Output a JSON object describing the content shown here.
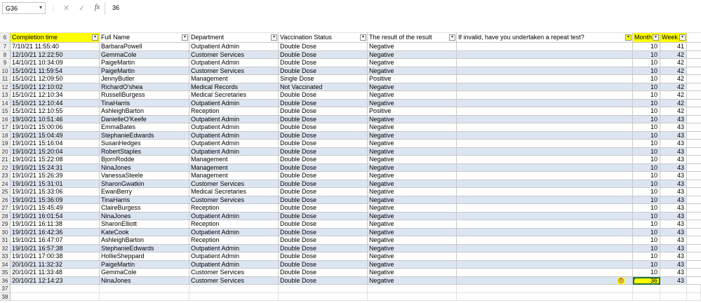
{
  "formula_bar": {
    "name_box": "G36",
    "name_box_arrow": "▾",
    "separator": "⋮",
    "cancel_icon": "✕",
    "enter_icon": "✓",
    "fx": "fx",
    "value": "36"
  },
  "headers": {
    "row_number": "6",
    "columns": [
      "Completion time",
      "Full Name",
      "Department",
      "Vaccination Status",
      "The result of the result",
      "If invalid, have you undertaken a repeat test?",
      "Month",
      "Week"
    ]
  },
  "rows": [
    {
      "n": "7",
      "t": "7/10/21 11:55:40",
      "name": "BarbaraPowell",
      "dept": "Outpatient Admin",
      "vacc": "Double Dose",
      "res": "Negative",
      "rep": "",
      "m": "10",
      "w": "41"
    },
    {
      "n": "8",
      "t": "12/10/21 12:22:50",
      "name": "GemmaCole",
      "dept": "Customer Services",
      "vacc": "Double Dose",
      "res": "Negative",
      "rep": "",
      "m": "10",
      "w": "42"
    },
    {
      "n": "9",
      "t": "14/10/21 10:34:09",
      "name": "PaigeMartin",
      "dept": "Outpatient Admin",
      "vacc": "Double Dose",
      "res": "Negative",
      "rep": "",
      "m": "10",
      "w": "42"
    },
    {
      "n": "10",
      "t": "15/10/21 11:59:54",
      "name": "PaigeMartin",
      "dept": "Customer Services",
      "vacc": "Double Dose",
      "res": "Negative",
      "rep": "",
      "m": "10",
      "w": "42"
    },
    {
      "n": "11",
      "t": "15/10/21 12:09:50",
      "name": "JennyButler",
      "dept": "Management",
      "vacc": "Single Dose",
      "res": "Positive",
      "rep": "",
      "m": "10",
      "w": "42"
    },
    {
      "n": "12",
      "t": "15/10/21 12:10:02",
      "name": "RichardO'shea",
      "dept": "Medical Records",
      "vacc": "Not Vaccinated",
      "res": "Negative",
      "rep": "",
      "m": "10",
      "w": "42"
    },
    {
      "n": "13",
      "t": "15/10/21 12:10:34",
      "name": "RussellBurgess",
      "dept": "Medical Secretaries",
      "vacc": "Double Dose",
      "res": "Negative",
      "rep": "",
      "m": "10",
      "w": "42"
    },
    {
      "n": "14",
      "t": "15/10/21 12:10:44",
      "name": "TinaHarris",
      "dept": "Outpatient Admin",
      "vacc": "Double Dose",
      "res": "Negative",
      "rep": "",
      "m": "10",
      "w": "42"
    },
    {
      "n": "15",
      "t": "15/10/21 12:10:55",
      "name": "AshleighBarton",
      "dept": "Reception",
      "vacc": "Double Dose",
      "res": "Positive",
      "rep": "",
      "m": "10",
      "w": "42"
    },
    {
      "n": "16",
      "t": "19/10/21 10:51:46",
      "name": "DanielleO'Keefe",
      "dept": "Outpatient Admin",
      "vacc": "Double Dose",
      "res": "Negative",
      "rep": "",
      "m": "10",
      "w": "43"
    },
    {
      "n": "17",
      "t": "19/10/21 15:00:06",
      "name": "EmmaBates",
      "dept": "Outpatient Admin",
      "vacc": "Double Dose",
      "res": "Negative",
      "rep": "",
      "m": "10",
      "w": "43"
    },
    {
      "n": "18",
      "t": "19/10/21 15:04:49",
      "name": "StephanieEdwards",
      "dept": "Outpatient Admin",
      "vacc": "Double Dose",
      "res": "Negative",
      "rep": "",
      "m": "10",
      "w": "43"
    },
    {
      "n": "19",
      "t": "19/10/21 15:16:04",
      "name": "SusanHedges",
      "dept": "Outpatient Admin",
      "vacc": "Double Dose",
      "res": "Negative",
      "rep": "",
      "m": "10",
      "w": "43"
    },
    {
      "n": "20",
      "t": "19/10/21 15:20:04",
      "name": "RobertStaples",
      "dept": "Outpatient Admin",
      "vacc": "Double Dose",
      "res": "Negative",
      "rep": "",
      "m": "10",
      "w": "43"
    },
    {
      "n": "21",
      "t": "19/10/21 15:22:08",
      "name": "BjornRodde",
      "dept": "Management",
      "vacc": "Double Dose",
      "res": "Negative",
      "rep": "",
      "m": "10",
      "w": "43"
    },
    {
      "n": "22",
      "t": "19/10/21 15:24:31",
      "name": "NinaJones",
      "dept": "Management",
      "vacc": "Double Dose",
      "res": "Negative",
      "rep": "",
      "m": "10",
      "w": "43"
    },
    {
      "n": "23",
      "t": "19/10/21 15:26:39",
      "name": "VanessaSteele",
      "dept": "Management",
      "vacc": "Double Dose",
      "res": "Negative",
      "rep": "",
      "m": "10",
      "w": "43"
    },
    {
      "n": "24",
      "t": "19/10/21 15:31:01",
      "name": "SharonGwatkin",
      "dept": "Customer Services",
      "vacc": "Double Dose",
      "res": "Negative",
      "rep": "",
      "m": "10",
      "w": "43"
    },
    {
      "n": "25",
      "t": "19/10/21 15:33:06",
      "name": "EwanBerry",
      "dept": "Medical Secretaries",
      "vacc": "Double Dose",
      "res": "Negative",
      "rep": "",
      "m": "10",
      "w": "43"
    },
    {
      "n": "26",
      "t": "19/10/21 15:36:09",
      "name": "TinaHarris",
      "dept": "Customer Services",
      "vacc": "Double Dose",
      "res": "Negative",
      "rep": "",
      "m": "10",
      "w": "43"
    },
    {
      "n": "27",
      "t": "19/10/21 15:45:49",
      "name": "ClaireBurgess",
      "dept": "Reception",
      "vacc": "Double Dose",
      "res": "Negative",
      "rep": "",
      "m": "10",
      "w": "43"
    },
    {
      "n": "28",
      "t": "19/10/21 16:01:54",
      "name": "NinaJones",
      "dept": "Outpatient Admin",
      "vacc": "Double Dose",
      "res": "Negative",
      "rep": "",
      "m": "10",
      "w": "43"
    },
    {
      "n": "29",
      "t": "19/10/21 16:11:38",
      "name": "SharonElliott",
      "dept": "Reception",
      "vacc": "Double Dose",
      "res": "Negative",
      "rep": "",
      "m": "10",
      "w": "43"
    },
    {
      "n": "30",
      "t": "19/10/21 16:42:36",
      "name": "KateCook",
      "dept": "Outpatient Admin",
      "vacc": "Double Dose",
      "res": "Negative",
      "rep": "",
      "m": "10",
      "w": "43"
    },
    {
      "n": "31",
      "t": "19/10/21 16:47:07",
      "name": "AshleighBarton",
      "dept": "Reception",
      "vacc": "Double Dose",
      "res": "Negative",
      "rep": "",
      "m": "10",
      "w": "43"
    },
    {
      "n": "32",
      "t": "19/10/21 16:57:38",
      "name": "StephanieEdwards",
      "dept": "Outpatient Admin",
      "vacc": "Double Dose",
      "res": "Negative",
      "rep": "",
      "m": "10",
      "w": "43"
    },
    {
      "n": "33",
      "t": "19/10/21 17:00:38",
      "name": "HollieSheppard",
      "dept": "Outpatient Admin",
      "vacc": "Double Dose",
      "res": "Negative",
      "rep": "",
      "m": "10",
      "w": "43"
    },
    {
      "n": "34",
      "t": "20/10/21 11:32:32",
      "name": "PaigeMartin",
      "dept": "Outpatient Admin",
      "vacc": "Double Dose",
      "res": "Negative",
      "rep": "",
      "m": "10",
      "w": "43"
    },
    {
      "n": "35",
      "t": "20/10/21 11:33:48",
      "name": "GemmaCole",
      "dept": "Customer Services",
      "vacc": "Double Dose",
      "res": "Negative",
      "rep": "",
      "m": "10",
      "w": "43"
    },
    {
      "n": "36",
      "t": "20/10/21 12:14:23",
      "name": "NinaJones",
      "dept": "Customer Services",
      "vacc": "Double Dose",
      "res": "Negative",
      "rep": "",
      "m": "36",
      "w": "43"
    }
  ],
  "empty_rows": [
    "37",
    "38"
  ],
  "filter_icon": "▾",
  "warning_icon": "!",
  "colors": {
    "highlight": "#ffff00",
    "band": "#dce6f1",
    "selection": "#217346"
  }
}
